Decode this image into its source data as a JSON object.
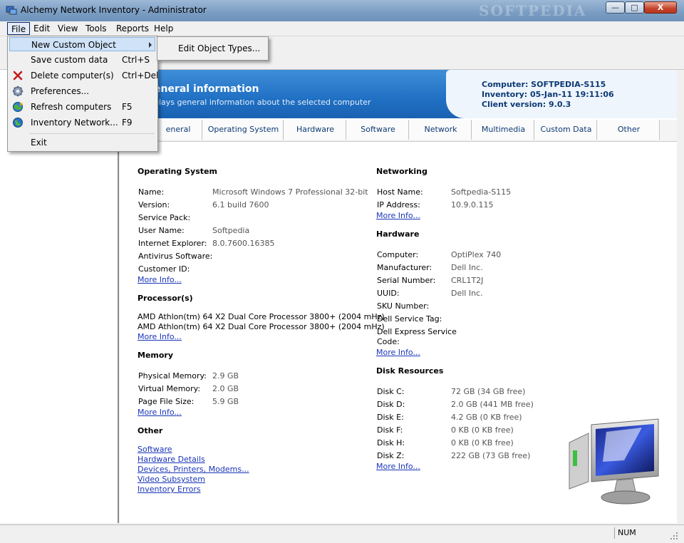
{
  "window": {
    "title": "Alchemy Network Inventory - Administrator",
    "watermark": "SOFTPEDIA",
    "minimize_glyph": "—",
    "maximize_glyph": "□",
    "close_glyph": "X"
  },
  "menubar": {
    "items": [
      {
        "label": "File"
      },
      {
        "label": "Edit"
      },
      {
        "label": "View"
      },
      {
        "label": "Tools"
      },
      {
        "label": "Reports"
      },
      {
        "label": "Help"
      }
    ]
  },
  "file_menu": {
    "items": [
      {
        "label": "New Custom Object",
        "shortcut": ""
      },
      {
        "label": "Save custom data",
        "shortcut": "Ctrl+S"
      },
      {
        "label": "Delete computer(s)",
        "shortcut": "Ctrl+Del"
      },
      {
        "label": "Preferences...",
        "shortcut": ""
      },
      {
        "label": "Refresh computers",
        "shortcut": "F5"
      },
      {
        "label": "Inventory Network...",
        "shortcut": "F9"
      },
      {
        "label": "Exit",
        "shortcut": ""
      }
    ]
  },
  "submenu": {
    "label": "Edit Object Types..."
  },
  "banner": {
    "title": "eneral information",
    "subtitle": "plays general information about the selected computer",
    "computer": "Computer: SOFTPEDIA-S115",
    "inventory": "Inventory: 05-Jan-11 19:11:06",
    "client_version": "Client version: 9.0.3"
  },
  "tabs": [
    {
      "label": "eneral"
    },
    {
      "label": "Operating System"
    },
    {
      "label": "Hardware"
    },
    {
      "label": "Software"
    },
    {
      "label": "Network"
    },
    {
      "label": "Multimedia"
    },
    {
      "label": "Custom Data"
    },
    {
      "label": "Other"
    }
  ],
  "os": {
    "title": "Operating System",
    "rows": [
      {
        "label": "Name:",
        "value": "Microsoft Windows 7 Professional 32-bit"
      },
      {
        "label": "Version:",
        "value": "6.1 build 7600"
      },
      {
        "label": "Service Pack:",
        "value": ""
      },
      {
        "label": "User Name:",
        "value": "Softpedia"
      },
      {
        "label": "Internet Explorer:",
        "value": "8.0.7600.16385"
      },
      {
        "label": "Antivirus Software:",
        "value": ""
      },
      {
        "label": "Customer ID:",
        "value": ""
      }
    ],
    "more": "More Info..."
  },
  "processor": {
    "title": "Processor(s)",
    "lines": [
      "AMD Athlon(tm) 64 X2 Dual Core Processor 3800+ (2004 mHz)",
      "AMD Athlon(tm) 64 X2 Dual Core Processor 3800+ (2004 mHz)"
    ],
    "more": "More Info..."
  },
  "memory": {
    "title": "Memory",
    "rows": [
      {
        "label": "Physical Memory:",
        "value": "2.9 GB"
      },
      {
        "label": "Virtual Memory:",
        "value": "2.0 GB"
      },
      {
        "label": "Page File Size:",
        "value": "5.9 GB"
      }
    ],
    "more": "More Info..."
  },
  "other": {
    "title": "Other",
    "links": [
      "Software",
      "Hardware Details",
      "Devices, Printers, Modems...",
      "Video Subsystem",
      "Inventory Errors"
    ]
  },
  "networking": {
    "title": "Networking",
    "rows": [
      {
        "label": "Host Name:",
        "value": "Softpedia-S115"
      },
      {
        "label": "IP Address:",
        "value": "10.9.0.115"
      }
    ],
    "more": "More Info..."
  },
  "hardware": {
    "title": "Hardware",
    "rows": [
      {
        "label": "Computer:",
        "value": "OptiPlex 740"
      },
      {
        "label": "Manufacturer:",
        "value": "Dell Inc."
      },
      {
        "label": "Serial Number:",
        "value": "CRL1T2J"
      },
      {
        "label": "UUID:",
        "value": "Dell Inc."
      },
      {
        "label": "SKU Number:",
        "value": ""
      },
      {
        "label": "Dell Service Tag:",
        "value": ""
      }
    ],
    "express_label_1": "Dell Express Service",
    "express_label_2": "Code:",
    "more": "More Info..."
  },
  "disks": {
    "title": "Disk Resources",
    "rows": [
      {
        "label": "Disk C:",
        "value": "72 GB (34 GB free)"
      },
      {
        "label": "Disk D:",
        "value": "2.0 GB (441 MB free)"
      },
      {
        "label": "Disk E:",
        "value": "4.2 GB (0 KB free)"
      },
      {
        "label": "Disk F:",
        "value": "0 KB (0 KB free)"
      },
      {
        "label": "Disk H:",
        "value": "0 KB (0 KB free)"
      },
      {
        "label": "Disk Z:",
        "value": "222 GB (73 GB free)"
      }
    ],
    "more": "More Info..."
  },
  "statusbar": {
    "num": "NUM"
  },
  "colors": {
    "accent_blue": "#2070c4",
    "link": "#1a35b8",
    "banner_text": "#0d3a74"
  }
}
